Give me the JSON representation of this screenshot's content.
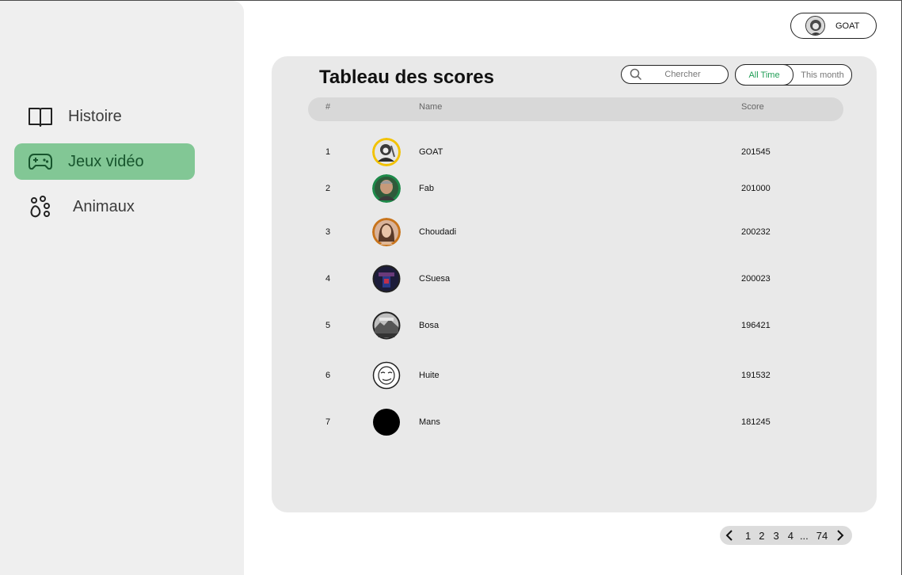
{
  "sidebar": {
    "items": [
      {
        "label": "Histoire",
        "icon": "book-icon",
        "active": false
      },
      {
        "label": "Jeux vidéo",
        "icon": "gamepad-icon",
        "active": true
      },
      {
        "label": "Animaux",
        "icon": "paw-icon",
        "active": false
      }
    ],
    "active_color": "#82c795"
  },
  "user": {
    "name": "GOAT"
  },
  "leaderboard": {
    "title": "Tableau des scores",
    "search_placeholder": "Chercher",
    "filters": {
      "all_time": "All Time",
      "this_month": "This month",
      "selected": "All Time"
    },
    "columns": {
      "rank": "#",
      "name": "Name",
      "score": "Score"
    },
    "rows": [
      {
        "rank": "1",
        "name": "GOAT",
        "score": "201545",
        "avatar_ring": "#f2c200"
      },
      {
        "rank": "2",
        "name": "Fab",
        "score": "201000",
        "avatar_ring": "#1e8a4a"
      },
      {
        "rank": "3",
        "name": "Choudadi",
        "score": "200232",
        "avatar_ring": "#c8741c"
      },
      {
        "rank": "4",
        "name": "CSuesa",
        "score": "200023",
        "avatar_ring": "#222222"
      },
      {
        "rank": "5",
        "name": "Bosa",
        "score": "196421",
        "avatar_ring": "#222222"
      },
      {
        "rank": "6",
        "name": "Huite",
        "score": "191532",
        "avatar_ring": "#222222"
      },
      {
        "rank": "7",
        "name": "Mans",
        "score": "181245",
        "avatar_ring": "#000000"
      }
    ]
  },
  "pagination": {
    "pages": [
      "1",
      "2",
      "3",
      "4",
      "...",
      "74"
    ]
  }
}
